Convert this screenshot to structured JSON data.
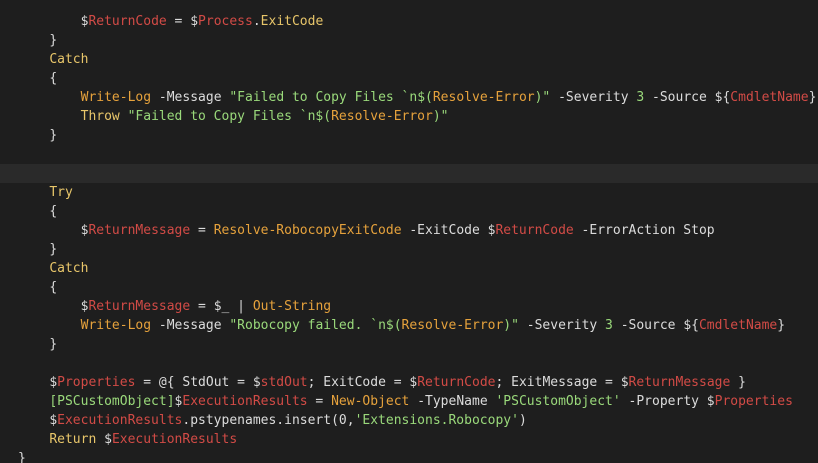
{
  "editor": {
    "colors": {
      "background": "#1e1e1e",
      "default": "#dcdcdc",
      "keyword": "#e8c66a",
      "cmdlet": "#e6a23c",
      "variable": "#d24b46",
      "string": "#9ad97b",
      "number": "#b5cea8"
    },
    "current_line_index": 8,
    "lines": [
      {
        "indent": "        ",
        "tokens": [
          {
            "t": "$",
            "c": "default"
          },
          {
            "t": "ReturnCode",
            "c": "variable"
          },
          {
            "t": " = ",
            "c": "default"
          },
          {
            "t": "$",
            "c": "default"
          },
          {
            "t": "Process",
            "c": "variable"
          },
          {
            "t": ".",
            "c": "default"
          },
          {
            "t": "ExitCode",
            "c": "keyword"
          }
        ]
      },
      {
        "indent": "    ",
        "tokens": [
          {
            "t": "}",
            "c": "default"
          }
        ]
      },
      {
        "indent": "    ",
        "tokens": [
          {
            "t": "Catch",
            "c": "keyword"
          }
        ]
      },
      {
        "indent": "    ",
        "tokens": [
          {
            "t": "{",
            "c": "default"
          }
        ]
      },
      {
        "indent": "        ",
        "tokens": [
          {
            "t": "Write-Log",
            "c": "cmdlet"
          },
          {
            "t": " -Message ",
            "c": "default"
          },
          {
            "t": "\"Failed to Copy Files `n$(",
            "c": "string"
          },
          {
            "t": "Resolve-Error",
            "c": "cmdlet"
          },
          {
            "t": ")\"",
            "c": "string"
          },
          {
            "t": " -Severity ",
            "c": "default"
          },
          {
            "t": "3",
            "c": "string"
          },
          {
            "t": " -Source ",
            "c": "default"
          },
          {
            "t": "${",
            "c": "default"
          },
          {
            "t": "CmdletName",
            "c": "variable"
          },
          {
            "t": "}",
            "c": "default"
          }
        ]
      },
      {
        "indent": "        ",
        "tokens": [
          {
            "t": "Throw",
            "c": "keyword"
          },
          {
            "t": " ",
            "c": "default"
          },
          {
            "t": "\"Failed to Copy Files `n$(",
            "c": "string"
          },
          {
            "t": "Resolve-Error",
            "c": "cmdlet"
          },
          {
            "t": ")\"",
            "c": "string"
          }
        ]
      },
      {
        "indent": "    ",
        "tokens": [
          {
            "t": "}",
            "c": "default"
          }
        ]
      },
      {
        "indent": "",
        "tokens": []
      },
      {
        "indent": "",
        "tokens": []
      },
      {
        "indent": "    ",
        "tokens": [
          {
            "t": "Try",
            "c": "keyword"
          }
        ]
      },
      {
        "indent": "    ",
        "tokens": [
          {
            "t": "{",
            "c": "default"
          }
        ]
      },
      {
        "indent": "        ",
        "tokens": [
          {
            "t": "$",
            "c": "default"
          },
          {
            "t": "ReturnMessage",
            "c": "variable"
          },
          {
            "t": " = ",
            "c": "default"
          },
          {
            "t": "Resolve-RobocopyExitCode",
            "c": "cmdlet"
          },
          {
            "t": " -ExitCode ",
            "c": "default"
          },
          {
            "t": "$",
            "c": "default"
          },
          {
            "t": "ReturnCode",
            "c": "variable"
          },
          {
            "t": " -ErrorAction Stop",
            "c": "default"
          }
        ]
      },
      {
        "indent": "    ",
        "tokens": [
          {
            "t": "}",
            "c": "default"
          }
        ]
      },
      {
        "indent": "    ",
        "tokens": [
          {
            "t": "Catch",
            "c": "keyword"
          }
        ]
      },
      {
        "indent": "    ",
        "tokens": [
          {
            "t": "{",
            "c": "default"
          }
        ]
      },
      {
        "indent": "        ",
        "tokens": [
          {
            "t": "$",
            "c": "default"
          },
          {
            "t": "ReturnMessage",
            "c": "variable"
          },
          {
            "t": " = ",
            "c": "default"
          },
          {
            "t": "$_",
            "c": "default"
          },
          {
            "t": " | ",
            "c": "default"
          },
          {
            "t": "Out-String",
            "c": "cmdlet"
          }
        ]
      },
      {
        "indent": "        ",
        "tokens": [
          {
            "t": "Write-Log",
            "c": "cmdlet"
          },
          {
            "t": " -Message ",
            "c": "default"
          },
          {
            "t": "\"Robocopy failed. `n$(",
            "c": "string"
          },
          {
            "t": "Resolve-Error",
            "c": "cmdlet"
          },
          {
            "t": ")\"",
            "c": "string"
          },
          {
            "t": " -Severity ",
            "c": "default"
          },
          {
            "t": "3",
            "c": "string"
          },
          {
            "t": " -Source ",
            "c": "default"
          },
          {
            "t": "${",
            "c": "default"
          },
          {
            "t": "CmdletName",
            "c": "variable"
          },
          {
            "t": "}",
            "c": "default"
          }
        ]
      },
      {
        "indent": "    ",
        "tokens": [
          {
            "t": "}",
            "c": "default"
          }
        ]
      },
      {
        "indent": "",
        "tokens": []
      },
      {
        "indent": "    ",
        "tokens": [
          {
            "t": "$",
            "c": "default"
          },
          {
            "t": "Properties",
            "c": "variable"
          },
          {
            "t": " = @{ StdOut = ",
            "c": "default"
          },
          {
            "t": "$",
            "c": "default"
          },
          {
            "t": "stdOut",
            "c": "variable"
          },
          {
            "t": "; ExitCode = ",
            "c": "default"
          },
          {
            "t": "$",
            "c": "default"
          },
          {
            "t": "ReturnCode",
            "c": "variable"
          },
          {
            "t": "; ExitMessage = ",
            "c": "default"
          },
          {
            "t": "$",
            "c": "default"
          },
          {
            "t": "ReturnMessage",
            "c": "variable"
          },
          {
            "t": " }",
            "c": "default"
          }
        ]
      },
      {
        "indent": "    ",
        "tokens": [
          {
            "t": "[PSCustomObject]",
            "c": "string"
          },
          {
            "t": "$",
            "c": "default"
          },
          {
            "t": "ExecutionResults",
            "c": "variable"
          },
          {
            "t": " = ",
            "c": "default"
          },
          {
            "t": "New-Object",
            "c": "cmdlet"
          },
          {
            "t": " -TypeName ",
            "c": "default"
          },
          {
            "t": "'PSCustomObject'",
            "c": "string"
          },
          {
            "t": " -Property ",
            "c": "default"
          },
          {
            "t": "$",
            "c": "default"
          },
          {
            "t": "Properties",
            "c": "variable"
          }
        ]
      },
      {
        "indent": "    ",
        "tokens": [
          {
            "t": "$",
            "c": "default"
          },
          {
            "t": "ExecutionResults",
            "c": "variable"
          },
          {
            "t": ".pstypenames.insert(0,",
            "c": "default"
          },
          {
            "t": "'Extensions.Robocopy'",
            "c": "string"
          },
          {
            "t": ")",
            "c": "default"
          }
        ]
      },
      {
        "indent": "    ",
        "tokens": [
          {
            "t": "Return",
            "c": "keyword"
          },
          {
            "t": " ",
            "c": "default"
          },
          {
            "t": "$",
            "c": "default"
          },
          {
            "t": "ExecutionResults",
            "c": "variable"
          }
        ]
      },
      {
        "indent": "",
        "tokens": [
          {
            "t": "}",
            "c": "default"
          }
        ]
      }
    ]
  }
}
